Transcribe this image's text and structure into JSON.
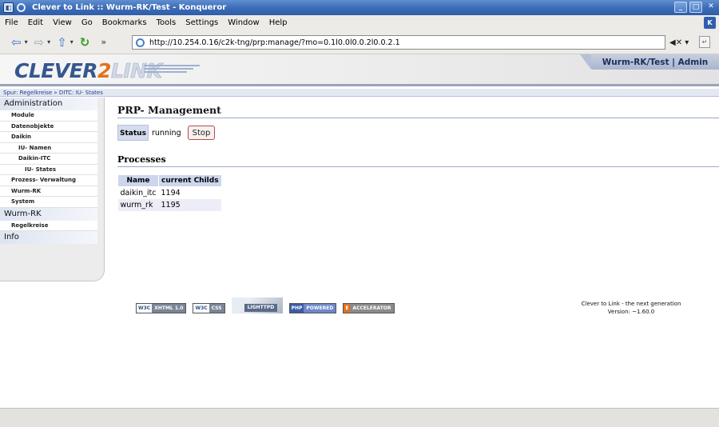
{
  "window": {
    "title": "Clever to Link :: Wurm-RK/Test - Konqueror"
  },
  "menubar": {
    "items": [
      "File",
      "Edit",
      "View",
      "Go",
      "Bookmarks",
      "Tools",
      "Settings",
      "Window",
      "Help"
    ]
  },
  "toolbar": {
    "url": "http://10.254.0.16/c2k-tng/prp:manage/?mo=0.1l0.0l0.0.2l0.0.2.1",
    "more_label": "»"
  },
  "banner": {
    "logo_part1": "CLEVER",
    "logo_part2": "2",
    "logo_part3": "LINK",
    "user_context": "Wurm-RK/Test | Admin"
  },
  "breadcrumb": "Spur: Regelkreise » DITC: IU- States",
  "sidebar": {
    "sections": [
      {
        "label": "Administration",
        "items": [
          {
            "label": "Module",
            "level": 1
          },
          {
            "label": "Datenobjekte",
            "level": 1
          },
          {
            "label": "Daikin",
            "level": 1
          },
          {
            "label": "IU- Namen",
            "level": 2
          },
          {
            "label": "Daikin-ITC",
            "level": 2
          },
          {
            "label": "IU- States",
            "level": 3
          },
          {
            "label": "Prozess- Verwaltung",
            "level": 1
          },
          {
            "label": "Wurm-RK",
            "level": 1
          },
          {
            "label": "System",
            "level": 1
          }
        ]
      },
      {
        "label": "Wurm-RK",
        "items": [
          {
            "label": "Regelkreise",
            "level": 1
          }
        ]
      },
      {
        "label": "Info",
        "items": []
      }
    ]
  },
  "main": {
    "title": "PRP- Management",
    "status_label": "Status",
    "status_value": "running",
    "stop_label": "Stop",
    "processes_title": "Processes",
    "table": {
      "headers": [
        "Name",
        "current Childs"
      ],
      "rows": [
        [
          "daikin_itc",
          "1194"
        ],
        [
          "wurm_rk",
          "1195"
        ]
      ]
    }
  },
  "footer": {
    "badges": [
      {
        "left": "W3C",
        "right": "XHTML 1.0",
        "style": "w3c"
      },
      {
        "left": "W3C",
        "right": "CSS",
        "style": "w3c"
      },
      {
        "left": "",
        "right": "LIGHTTPD",
        "style": "light"
      },
      {
        "left": "PHP",
        "right": "POWERED",
        "style": "php"
      },
      {
        "left": "E",
        "right": "ACCELERATOR",
        "style": "eacc"
      }
    ],
    "line1": "Clever to Link - the next generation",
    "line2": "Version: ~1.60.0"
  }
}
